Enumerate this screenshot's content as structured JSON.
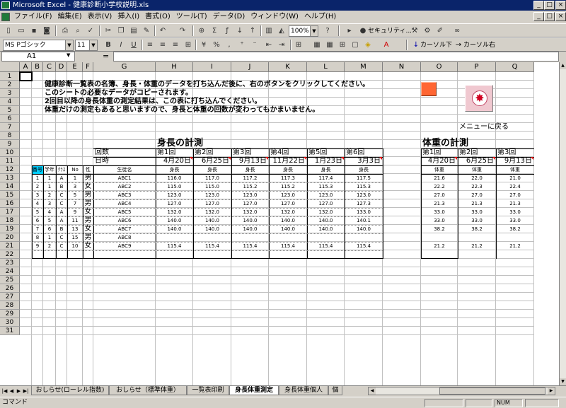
{
  "window": {
    "title": "Microsoft Excel - 健康診断小学校説明.xls",
    "min": "_",
    "max": "□",
    "close": "×"
  },
  "menu": {
    "items": [
      "ファイル(F)",
      "編集(E)",
      "表示(V)",
      "挿入(I)",
      "書式(O)",
      "ツール(T)",
      "データ(D)",
      "ウィンドウ(W)",
      "ヘルプ(H)"
    ]
  },
  "toolbar1": {
    "zoom": "100%",
    "security": "セキュリティ..."
  },
  "toolbar2": {
    "font_name": "MS Pゴシック",
    "font_size": "11",
    "bold": "B",
    "italic": "I",
    "underline": "U",
    "cursor_down": "カーソル下",
    "cursor_right": "カーソル右"
  },
  "formula": {
    "name_box": "A1",
    "fx": "="
  },
  "columns": [
    "A",
    "B",
    "C",
    "D",
    "E",
    "F",
    "G",
    "H",
    "I",
    "J",
    "K",
    "L",
    "M",
    "N",
    "O",
    "P",
    "Q"
  ],
  "rows": [
    "1",
    "2",
    "3",
    "4",
    "5",
    "6",
    "7",
    "8",
    "9",
    "10",
    "11",
    "12",
    "13",
    "14",
    "15",
    "16",
    "17",
    "18",
    "19",
    "20",
    "21",
    "22",
    "23",
    "24",
    "25",
    "26",
    "27",
    "28",
    "29",
    "30",
    "31"
  ],
  "instructions": [
    "健康診断一覧表の名簿、身長・体重のデータを打ち込んだ後に、右のボタンをクリックしてください。",
    "このシートの必要なデータがコピーされます。",
    "2回目以降の身長体重の測定結果は、この表に打ち込んでください。",
    "体重だけの測定もあると思いますので、身長と体重の回数が変わってもかまいません。"
  ],
  "menu_return": "メニューに戻る",
  "height_title": "身長の計測",
  "weight_title": "体重の計測",
  "label_kaisu": "回数",
  "label_nichiji": "日時",
  "height_rounds": [
    "第1回",
    "第2回",
    "第3回",
    "第4回",
    "第5回",
    "第6回"
  ],
  "height_dates": [
    "4月20日",
    "6月25日",
    "9月13日",
    "11月22日",
    "1月23日",
    "3月3日"
  ],
  "weight_rounds": [
    "第1回",
    "第2回",
    "第3回"
  ],
  "weight_dates": [
    "4月20日",
    "6月25日",
    "9月13日"
  ],
  "hdr": {
    "bango": "番号",
    "gakunen": "学年",
    "class": "ｸﾗｽ",
    "no": "No",
    "sei": "性",
    "name": "生徒名",
    "height": "身長",
    "weight": "体重"
  },
  "students": [
    {
      "n": "1",
      "g": "1",
      "c": "A",
      "no": "1",
      "s": "男",
      "name": "ABC1",
      "h": [
        "116.0",
        "117.0",
        "117.2",
        "117.3",
        "117.4",
        "117.5"
      ],
      "w": [
        "21.6",
        "22.0",
        "21.0"
      ]
    },
    {
      "n": "2",
      "g": "1",
      "c": "B",
      "no": "3",
      "s": "女",
      "name": "ABC2",
      "h": [
        "115.0",
        "115.0",
        "115.2",
        "115.2",
        "115.3",
        "115.3"
      ],
      "w": [
        "22.2",
        "22.3",
        "22.4"
      ]
    },
    {
      "n": "3",
      "g": "2",
      "c": "C",
      "no": "5",
      "s": "男",
      "name": "ABC3",
      "h": [
        "123.0",
        "123.0",
        "123.0",
        "123.0",
        "123.0",
        "123.0"
      ],
      "w": [
        "27.0",
        "27.0",
        "27.0"
      ]
    },
    {
      "n": "4",
      "g": "3",
      "c": "C",
      "no": "7",
      "s": "男",
      "name": "ABC4",
      "h": [
        "127.0",
        "127.0",
        "127.0",
        "127.0",
        "127.0",
        "127.3"
      ],
      "w": [
        "21.3",
        "21.3",
        "21.3"
      ]
    },
    {
      "n": "5",
      "g": "4",
      "c": "A",
      "no": "9",
      "s": "女",
      "name": "ABC5",
      "h": [
        "132.0",
        "132.0",
        "132.0",
        "132.0",
        "132.0",
        "133.0"
      ],
      "w": [
        "33.0",
        "33.0",
        "33.0"
      ]
    },
    {
      "n": "6",
      "g": "5",
      "c": "A",
      "no": "11",
      "s": "男",
      "name": "ABC6",
      "h": [
        "140.0",
        "140.0",
        "140.0",
        "140.0",
        "140.0",
        "140.1"
      ],
      "w": [
        "33.0",
        "33.0",
        "33.0"
      ]
    },
    {
      "n": "7",
      "g": "6",
      "c": "B",
      "no": "13",
      "s": "女",
      "name": "ABC7",
      "h": [
        "140.0",
        "140.0",
        "140.0",
        "140.0",
        "140.0",
        "140.0"
      ],
      "w": [
        "38.2",
        "38.2",
        "38.2"
      ]
    },
    {
      "n": "8",
      "g": "1",
      "c": "C",
      "no": "15",
      "s": "男",
      "name": "ABC8",
      "h": [
        "",
        "",
        "",
        "",
        "",
        ""
      ],
      "w": [
        "",
        "",
        ""
      ]
    },
    {
      "n": "9",
      "g": "2",
      "c": "C",
      "no": "10",
      "s": "女",
      "name": "ABC9",
      "h": [
        "115.4",
        "115.4",
        "115.4",
        "115.4",
        "115.4",
        "115.4"
      ],
      "w": [
        "21.2",
        "21.2",
        "21.2"
      ]
    }
  ],
  "sheet_tabs": [
    "おしらせ(ローレル指数)",
    "おしらせ（標準体重）",
    "一覧表印刷",
    "身長体重測定",
    "身長体重個人",
    "個"
  ],
  "active_tab": "身長体重測定",
  "status": {
    "mode": "コマンド",
    "num": "NUM"
  },
  "colors": {
    "title_bar": "#0a246a",
    "selected_header": "#00ccff",
    "copy_button": "#ff6633",
    "menu_button": "#f0c8d0"
  }
}
